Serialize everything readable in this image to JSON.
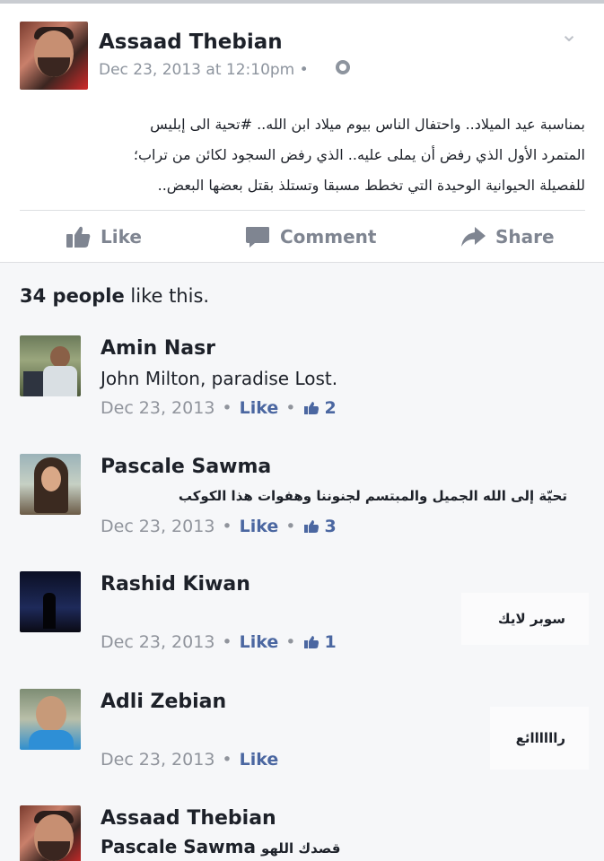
{
  "post": {
    "author": "Assaad Thebian",
    "timestamp": "Dec 23, 2013 at 12:10pm",
    "privacy_icon": "globe-icon",
    "menu_icon": "chevron-down-icon",
    "text_lines": [
      "بمناسبة عيد الميلاد.. واحتفال الناس بيوم ميلاد ابن الله.. #تحية الى إبليس",
      "المتمرد الأول الذي رفض أن يملى عليه.. الذي رفض السجود لكائن من تراب؛",
      "للفصيلة الحيوانية الوحيدة التي تخطط مسبقا وتستلذ بقتل بعضها البعض.."
    ],
    "actions": {
      "like": "Like",
      "comment": "Comment",
      "share": "Share"
    }
  },
  "likes_summary": {
    "count": "34 people",
    "suffix": " like this."
  },
  "comments": [
    {
      "name": "Amin Nasr",
      "text": "John Milton, paradise Lost.",
      "date": "Dec 23, 2013",
      "like_label": "Like",
      "like_count": "2"
    },
    {
      "name": "Pascale Sawma",
      "text": "تحيّة إلى الله الجميل والمبتسم لجنوننا وهفوات هذا الكوكب",
      "date": "Dec 23, 2013",
      "like_label": "Like",
      "like_count": "3"
    },
    {
      "name": "Rashid Kiwan",
      "text": "سوبر لايك",
      "date": "Dec 23, 2013",
      "like_label": "Like",
      "like_count": "1"
    },
    {
      "name": "Adli Zebian",
      "text": "راااااائع",
      "date": "Dec 23, 2013",
      "like_label": "Like"
    },
    {
      "name": "Assaad Thebian",
      "mention": "Pascale Sawma",
      "text": "قصدك اللهو"
    }
  ],
  "colors": {
    "page_bg": "#f6f7f9",
    "card_bg": "#ffffff",
    "meta_gray": "#90949c",
    "action_gray": "#7f8591",
    "link_blue": "#4b67a1"
  }
}
